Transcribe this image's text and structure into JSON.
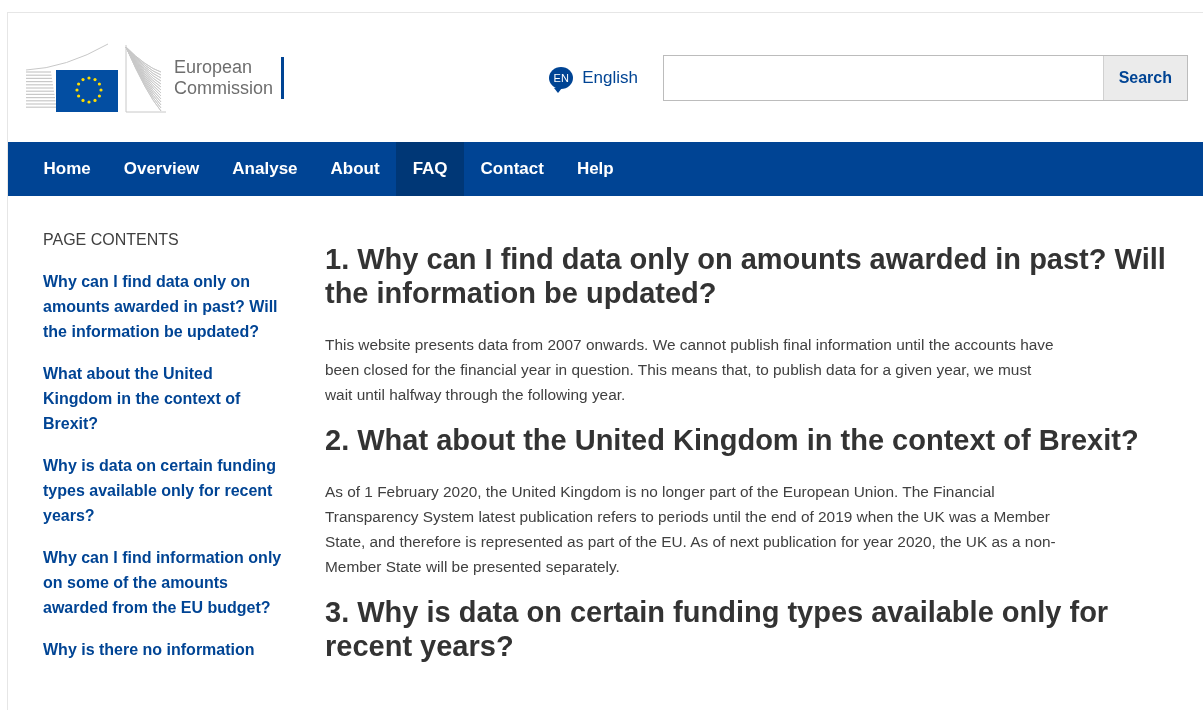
{
  "header": {
    "logo_text": [
      "European",
      "Commission"
    ],
    "language": {
      "code": "EN",
      "label": "English"
    },
    "search": {
      "button": "Search"
    }
  },
  "nav": [
    {
      "label": "Home",
      "selected": false
    },
    {
      "label": "Overview",
      "selected": false
    },
    {
      "label": "Analyse",
      "selected": false
    },
    {
      "label": "About",
      "selected": false
    },
    {
      "label": "FAQ",
      "selected": true
    },
    {
      "label": "Contact",
      "selected": false
    },
    {
      "label": "Help",
      "selected": false
    }
  ],
  "sidebar": {
    "title": "PAGE CONTENTS",
    "items": [
      "Why can I find data only on amounts awarded in past? Will the information be updated?",
      "What about the United Kingdom in the context of Brexit?",
      "Why is data on certain funding types available only for recent years?",
      "Why can I find information only on some of the amounts awarded from the EU budget?",
      "Why is there no information"
    ]
  },
  "sections": [
    {
      "heading": "1. Why can I find data only on amounts awarded in past? Will the information be updated?",
      "body": "This website presents data from 2007 onwards. We cannot publish final information until the accounts have been closed for the financial year in question. This means that, to publish data for a given year, we must wait until halfway through the following year."
    },
    {
      "heading": "2. What about the United Kingdom in the context of Brexit?",
      "body": "As of 1 February 2020, the United Kingdom is no longer part of the European Union. The Financial Transparency System latest publication refers to periods until the end of 2019 when the UK was a Member State, and therefore is represented as part of the EU. As of next publication for year 2020, the UK as a non-Member State will be presented separately."
    },
    {
      "heading": "3. Why is data on certain funding types available only for recent years?"
    }
  ]
}
